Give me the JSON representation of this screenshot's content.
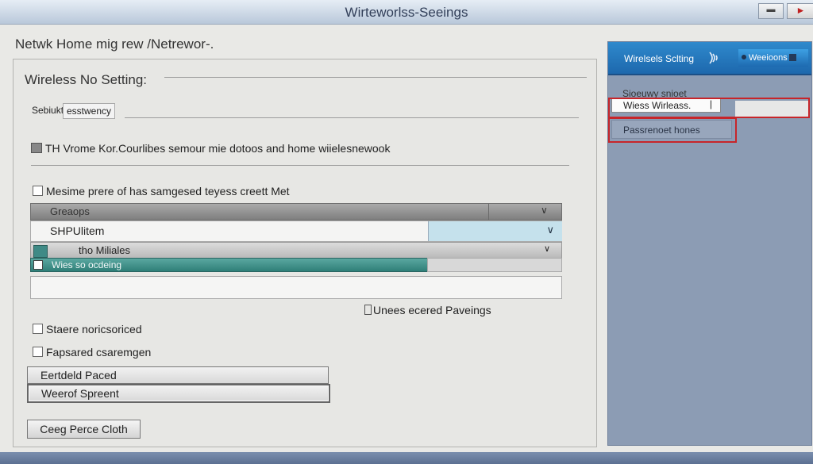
{
  "window": {
    "title": "Wirteworlss-Seeings",
    "minimize_icon": "minimize-icon",
    "close_icon": "close-icon"
  },
  "page": {
    "header": "Netwk Home mig  rew  /Netrewor-."
  },
  "main": {
    "group_title": "Wireless No Setting:",
    "tabs": [
      {
        "label": "Sebiukt"
      },
      {
        "label": "esstwency"
      }
    ],
    "description": "TH Vrome Kor.Courlibes semour mie dotoos and home wiielesnewook",
    "checkbox_main": "Mesime prere of has samgesed teyess creett Met",
    "grid": {
      "header_label": "Greaops",
      "row1_label": "SHPUlitem",
      "row2_label": "tho Miliales",
      "row3_label": "Wies so ocdeing"
    },
    "advanced_link": "Unees ecered Paveings",
    "checkbox_share": "Staere noricsoriced",
    "checkbox_password": "Fapsared csaremgen",
    "field1": "Eertdeld Paced",
    "field2": "Weerof Spreent",
    "bottom_button": "Ceeg Perce Cloth"
  },
  "sidebar": {
    "title": "Wirelsels Sclting",
    "wifi_icon": "wifi-icon",
    "network_button": "Weeioons",
    "security_label": "Sioeuwy snioet",
    "security_value": "Wiess Wirleass.",
    "password_label": "Passrenoet hones"
  },
  "colors": {
    "accent_blue": "#1e6ab0",
    "highlight_red": "#c7252a",
    "selected_teal": "#3f8a86"
  }
}
